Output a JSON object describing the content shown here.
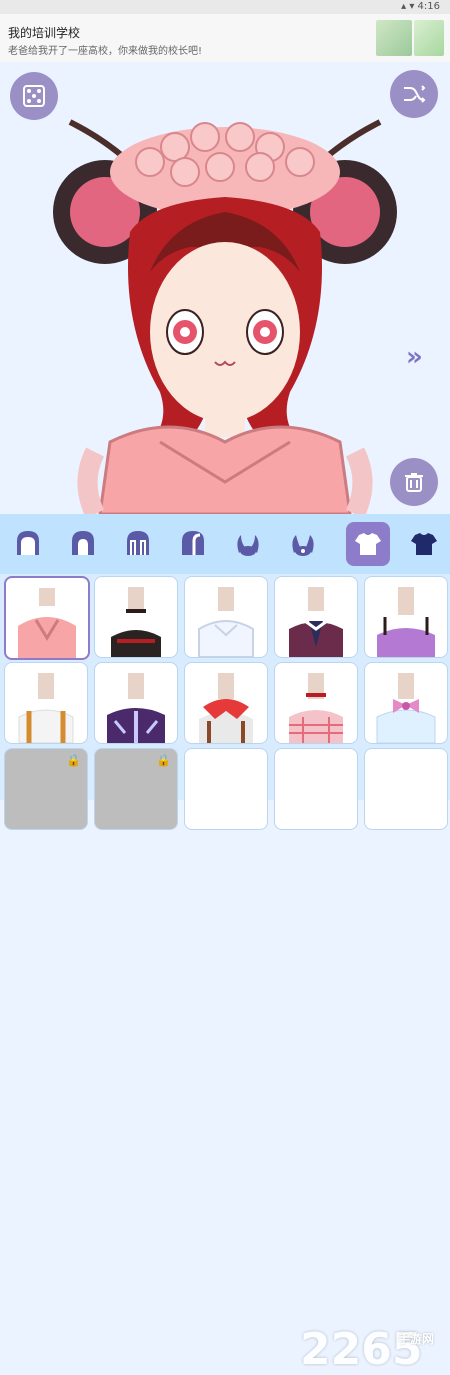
{
  "status_bar": {
    "right_text": "▴ ▾ 4:16"
  },
  "ad": {
    "title": "我的培训学校",
    "description": "老爸给我开了一座高校，你来做我的校长吧!"
  },
  "canvas": {
    "buttons": {
      "randomize": {
        "icon": "dice-icon"
      },
      "shuffle": {
        "icon": "shuffle-icon"
      },
      "trash": {
        "icon": "trash-icon"
      },
      "next": {
        "icon": "double-chevron-right-icon"
      }
    }
  },
  "category_tabs": [
    {
      "icon": "hair-back-icon-1"
    },
    {
      "icon": "hair-back-icon-2"
    },
    {
      "icon": "hair-back-icon-3"
    },
    {
      "icon": "hair-back-icon-4"
    },
    {
      "icon": "horns-icon"
    },
    {
      "icon": "ears-icon"
    },
    {
      "icon": "shirt-icon",
      "active": true
    },
    {
      "icon": "shirt-dark-icon"
    }
  ],
  "outfits": [
    {
      "id": "kimono",
      "locked": false,
      "selected": true
    },
    {
      "id": "choker-top",
      "locked": false
    },
    {
      "id": "crop-top",
      "locked": false
    },
    {
      "id": "school-vest",
      "locked": false
    },
    {
      "id": "purple-top",
      "locked": false
    },
    {
      "id": "overalls",
      "locked": false
    },
    {
      "id": "dark-coat",
      "locked": false
    },
    {
      "id": "red-bow",
      "locked": false
    },
    {
      "id": "plaid-top",
      "locked": false
    },
    {
      "id": "bow-blouse",
      "locked": false
    },
    {
      "id": "locked-1",
      "locked": true
    },
    {
      "id": "locked-2",
      "locked": true
    },
    {
      "id": "empty-1",
      "locked": false
    },
    {
      "id": "empty-2",
      "locked": false
    },
    {
      "id": "empty-3",
      "locked": false
    }
  ],
  "watermark": {
    "text": "2265",
    "suffix": "手游网",
    "domain": ".com"
  }
}
